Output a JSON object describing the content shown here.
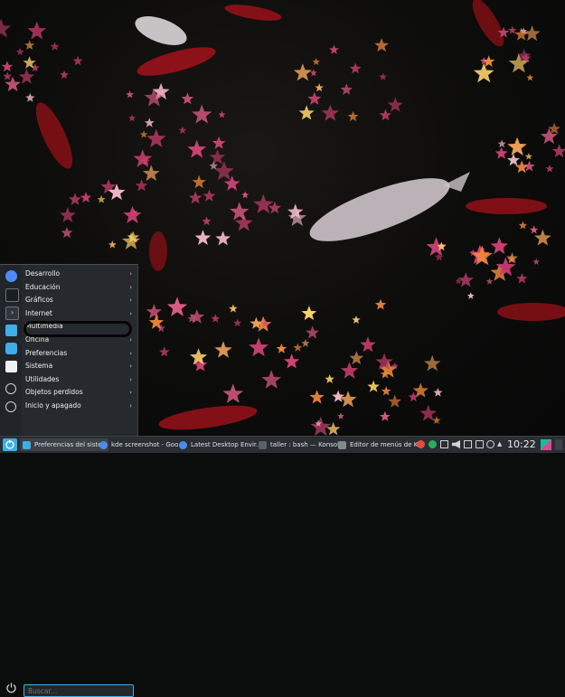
{
  "launcher": {
    "categories": [
      {
        "label": "Desarrollo"
      },
      {
        "label": "Educación"
      },
      {
        "label": "Gráficos"
      },
      {
        "label": "Internet"
      },
      {
        "label": "Multimedia"
      },
      {
        "label": "Oficina"
      },
      {
        "label": "Preferencias"
      },
      {
        "label": "Sistema"
      },
      {
        "label": "Utilidades"
      },
      {
        "label": "Objetos perdidos"
      },
      {
        "label": "Inicio y apagado"
      }
    ],
    "arrow_glyph": "›",
    "search_placeholder": "Buscar..."
  },
  "taskbar": {
    "tasks": [
      {
        "label": "Preferencias del siste...",
        "icon": "settings-icon",
        "color": "#3daee9"
      },
      {
        "label": "kde screenshot - Goo...",
        "icon": "chrome-icon",
        "color": "#4c8bf5"
      },
      {
        "label": "Latest Desktop Envir...",
        "icon": "chrome-icon",
        "color": "#4c8bf5"
      },
      {
        "label": "taller : bash — Konsole",
        "icon": "terminal-icon",
        "color": "#5a6168"
      },
      {
        "label": "Editor de menús de K...",
        "icon": "menu-editor-icon",
        "color": "#7f8c8d"
      }
    ],
    "clock": "10:22"
  },
  "colors": {
    "accent": "#3daee9",
    "panel": "#2a2e32",
    "koi_red": "#b3121b",
    "maple_pink": "#e8608a",
    "maple_orange": "#f08a3c"
  }
}
